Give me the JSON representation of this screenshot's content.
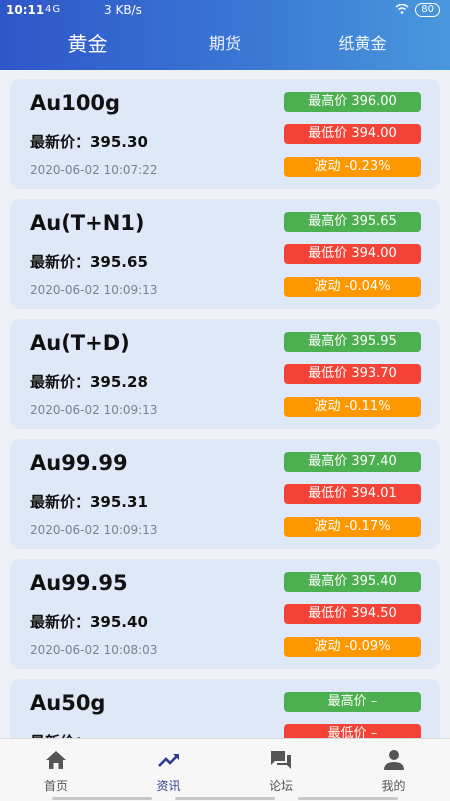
{
  "status": {
    "time": "10:11",
    "signal": "4G",
    "speed": "3 KB/s",
    "battery": "80"
  },
  "tabs": [
    {
      "label": "黄金",
      "active": true
    },
    {
      "label": "期货",
      "active": false
    },
    {
      "label": "纸黄金",
      "active": false
    }
  ],
  "labels": {
    "latest_prefix": "最新价：",
    "high_prefix": "最高价 ",
    "low_prefix": "最低价 ",
    "vol_prefix": "波动 "
  },
  "items": [
    {
      "name": "Au100g",
      "latest": "395.30",
      "time": "2020-06-02 10:07:22",
      "high": "396.00",
      "low": "394.00",
      "vol": "-0.23%"
    },
    {
      "name": "Au(T+N1)",
      "latest": "395.65",
      "time": "2020-06-02 10:09:13",
      "high": "395.65",
      "low": "394.00",
      "vol": "-0.04%"
    },
    {
      "name": "Au(T+D)",
      "latest": "395.28",
      "time": "2020-06-02 10:09:13",
      "high": "395.95",
      "low": "393.70",
      "vol": "-0.11%"
    },
    {
      "name": "Au99.99",
      "latest": "395.31",
      "time": "2020-06-02 10:09:13",
      "high": "397.40",
      "low": "394.01",
      "vol": "-0.17%"
    },
    {
      "name": "Au99.95",
      "latest": "395.40",
      "time": "2020-06-02 10:08:03",
      "high": "395.40",
      "low": "394.50",
      "vol": "-0.09%"
    },
    {
      "name": "Au50g",
      "latest": "",
      "time": "",
      "high": "–",
      "low": "–",
      "vol": ""
    }
  ],
  "nav": [
    {
      "label": "首页",
      "icon": "home-icon",
      "active": false
    },
    {
      "label": "资讯",
      "icon": "trending-icon",
      "active": true
    },
    {
      "label": "论坛",
      "icon": "forum-icon",
      "active": false
    },
    {
      "label": "我的",
      "icon": "person-icon",
      "active": false
    }
  ],
  "colors": {
    "header": "#2f56c8",
    "high": "#4caf50",
    "low": "#f44336",
    "volatility": "#ff9800",
    "card": "#dfe8f7"
  }
}
